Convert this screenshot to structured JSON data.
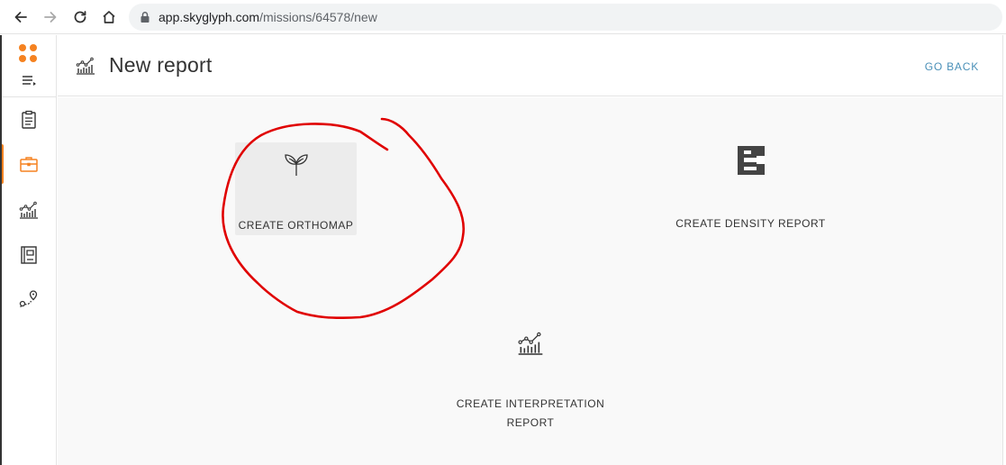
{
  "browser": {
    "url_host": "app.skyglyph.com",
    "url_path": "/missions/64578/new"
  },
  "sidebar": {
    "items": [
      {
        "icon": "clipboard-icon"
      },
      {
        "icon": "briefcase-icon",
        "active": true
      },
      {
        "icon": "analytics-icon"
      },
      {
        "icon": "notebook-icon"
      },
      {
        "icon": "route-icon"
      }
    ]
  },
  "header": {
    "title": "New report",
    "go_back": "GO BACK"
  },
  "cards": {
    "orthomap": "CREATE ORTHOMAP",
    "density": "CREATE DENSITY REPORT",
    "interpretation_line1": "CREATE INTERPRETATION",
    "interpretation_line2": "REPORT"
  },
  "colors": {
    "accent": "#f58220",
    "link": "#4a90b8",
    "annotation": "#e00000"
  }
}
